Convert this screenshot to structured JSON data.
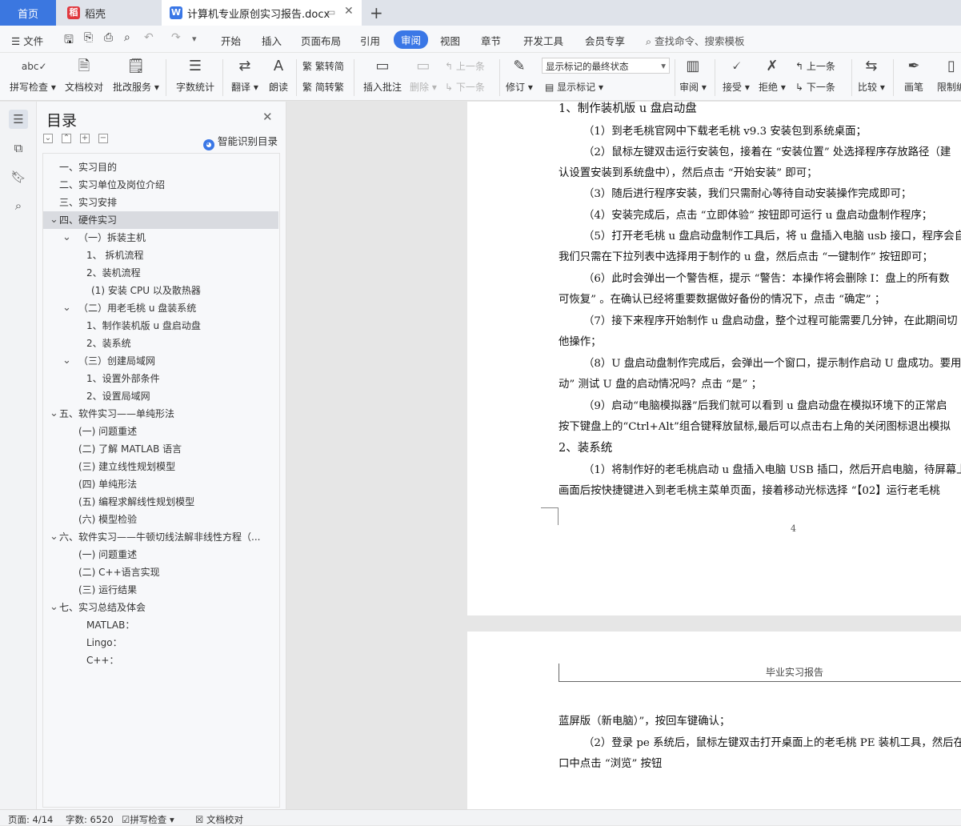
{
  "tabs": {
    "home": "首页",
    "daoke": "稻壳",
    "doc": "计算机专业原创实习报告.docx",
    "add": "+"
  },
  "menubar": {
    "file": "文件",
    "items": [
      "开始",
      "插入",
      "页面布局",
      "引用",
      "审阅",
      "视图",
      "章节",
      "开发工具",
      "会员专享"
    ],
    "search": "查找命令、搜索模板"
  },
  "toolbar": {
    "spell": "拼写检查",
    "doccheck": "文档校对",
    "annot_service": "批改服务",
    "wordcount": "字数统计",
    "translate": "翻译",
    "read": "朗读",
    "trad2simp": "繁转简",
    "simp2trad": "简转繁",
    "insert_comment": "插入批注",
    "delete": "删除",
    "prev": "上一条",
    "next": "下一条",
    "revise": "修订",
    "markup_select": "显示标记的最终状态",
    "show_markup": "显示标记",
    "review": "审阅",
    "accept": "接受",
    "reject": "拒绝",
    "prev2": "上一条",
    "next2": "下一条",
    "compare": "比较",
    "pen": "画笔",
    "restrict": "限制编"
  },
  "toc": {
    "title": "目录",
    "smart": "智能识别目录",
    "items": [
      {
        "label": "一、实习目的",
        "level": 0,
        "chev": ""
      },
      {
        "label": "二、实习单位及岗位介绍",
        "level": 0,
        "chev": ""
      },
      {
        "label": "三、实习安排",
        "level": 0,
        "chev": ""
      },
      {
        "label": "四、硬件实习",
        "level": 0,
        "chev": "v",
        "selected": true
      },
      {
        "label": "（一）拆装主机",
        "level": 1,
        "chev": "v"
      },
      {
        "label": "1、 拆机流程",
        "level": 2,
        "chev": ""
      },
      {
        "label": "2、装机流程",
        "level": 2,
        "chev": ""
      },
      {
        "label": "(1) 安装 CPU 以及散热器",
        "level": 3,
        "chev": ""
      },
      {
        "label": "（二）用老毛桃 u 盘装系统",
        "level": 1,
        "chev": "v"
      },
      {
        "label": "1、制作装机版 u 盘启动盘",
        "level": 2,
        "chev": ""
      },
      {
        "label": "2、装系统",
        "level": 2,
        "chev": ""
      },
      {
        "label": "（三）创建局域网",
        "level": 1,
        "chev": "v"
      },
      {
        "label": "1、设置外部条件",
        "level": 2,
        "chev": ""
      },
      {
        "label": "2、设置局域网",
        "level": 2,
        "chev": ""
      },
      {
        "label": "五、软件实习——单纯形法",
        "level": 0,
        "chev": "v"
      },
      {
        "label": "(一) 问题重述",
        "level": 1,
        "chev": ""
      },
      {
        "label": "(二) 了解 MATLAB 语言",
        "level": 1,
        "chev": ""
      },
      {
        "label": "(三) 建立线性规划模型",
        "level": 1,
        "chev": ""
      },
      {
        "label": "(四) 单纯形法",
        "level": 1,
        "chev": ""
      },
      {
        "label": "(五) 编程求解线性规划模型",
        "level": 1,
        "chev": ""
      },
      {
        "label": "(六) 模型检验",
        "level": 1,
        "chev": ""
      },
      {
        "label": "六、软件实习——牛顿切线法解非线性方程（...",
        "level": 0,
        "chev": "v"
      },
      {
        "label": "(一) 问题重述",
        "level": 1,
        "chev": ""
      },
      {
        "label": "(二) C++语言实现",
        "level": 1,
        "chev": ""
      },
      {
        "label": "(三) 运行结果",
        "level": 1,
        "chev": ""
      },
      {
        "label": "七、实习总结及体会",
        "level": 0,
        "chev": "v"
      },
      {
        "label": "MATLAB：",
        "level": 2,
        "chev": ""
      },
      {
        "label": "Lingo：",
        "level": 2,
        "chev": ""
      },
      {
        "label": "C++：",
        "level": 2,
        "chev": ""
      }
    ]
  },
  "doc": {
    "page1_lines": [
      {
        "text": "（二）用老毛桃 u 盘装系统",
        "indent": 0,
        "head": true
      },
      {
        "text": "1、制作装机版 u 盘启动盘",
        "indent": 0,
        "head": true
      },
      {
        "text": "（1）到老毛桃官网中下载老毛桃 v9.3 安装包到系统桌面；",
        "indent": 1
      },
      {
        "text": "（2）鼠标左键双击运行安装包，接着在 “安装位置” 处选择程序存放路径（建",
        "indent": 1
      },
      {
        "text": "认设置安装到系统盘中），然后点击 “开始安装” 即可；",
        "indent": 0
      },
      {
        "text": "（3）随后进行程序安装，我们只需耐心等待自动安装操作完成即可；",
        "indent": 1
      },
      {
        "text": "（4）安装完成后，点击 “立即体验” 按钮即可运行 u 盘启动盘制作程序；",
        "indent": 1
      },
      {
        "text": "（5）打开老毛桃 u 盘启动盘制作工具后，将 u 盘插入电脑 usb 接口，程序会自",
        "indent": 1
      },
      {
        "text": "我们只需在下拉列表中选择用于制作的 u 盘，然后点击 “一键制作” 按钮即可；",
        "indent": 0
      },
      {
        "text": "（6）此时会弹出一个警告框，提示 “警告：本操作将会删除 I：盘上的所有数",
        "indent": 1
      },
      {
        "text": "可恢复” 。在确认已经将重要数据做好备份的情况下，点击 “确定” ；",
        "indent": 0
      },
      {
        "text": "（7）接下来程序开始制作 u 盘启动盘，整个过程可能需要几分钟，在此期间切",
        "indent": 1
      },
      {
        "text": "他操作；",
        "indent": 0
      },
      {
        "text": "（8）U 盘启动盘制作完成后，会弹出一个窗口，提示制作启动 U 盘成功。要用",
        "indent": 1
      },
      {
        "text": "动” 测试 U 盘的启动情况吗？点击 “是” ；",
        "indent": 0
      },
      {
        "text": "（9）启动“电脑模拟器”后我们就可以看到 u 盘启动盘在模拟环境下的正常启",
        "indent": 1
      },
      {
        "text": "按下键盘上的“Ctrl+Alt”组合键释放鼠标,最后可以点击右上角的关闭图标退出模拟",
        "indent": 0
      },
      {
        "text": "2、装系统",
        "indent": 0,
        "head": true
      },
      {
        "text": "（1）将制作好的老毛桃启动 u 盘插入电脑 USB 插口，然后开启电脑，待屏幕上",
        "indent": 1
      },
      {
        "text": "画面后按快捷键进入到老毛桃主菜单页面，接着移动光标选择 “【02】运行老毛桃",
        "indent": 0
      }
    ],
    "page_number": "4",
    "header2": "毕业实习报告",
    "page2_lines": [
      {
        "text": "蓝屏版（新电脑）”，按回车键确认；",
        "indent": 0
      },
      {
        "text": "（2）登录 pe 系统后，鼠标左键双击打开桌面上的老毛桃 PE 装机工具，然后在",
        "indent": 1
      },
      {
        "text": "口中点击 “浏览” 按钮",
        "indent": 0
      }
    ]
  },
  "status": {
    "page": "页面: 4/14",
    "words": "字数: 6520",
    "spell": "拼写检查",
    "doccheck": "文档校对"
  },
  "colors": {
    "accent": "#3a77e6",
    "toc_selected": "#d9dbe0",
    "doc_bg": "#e6e6e6"
  }
}
